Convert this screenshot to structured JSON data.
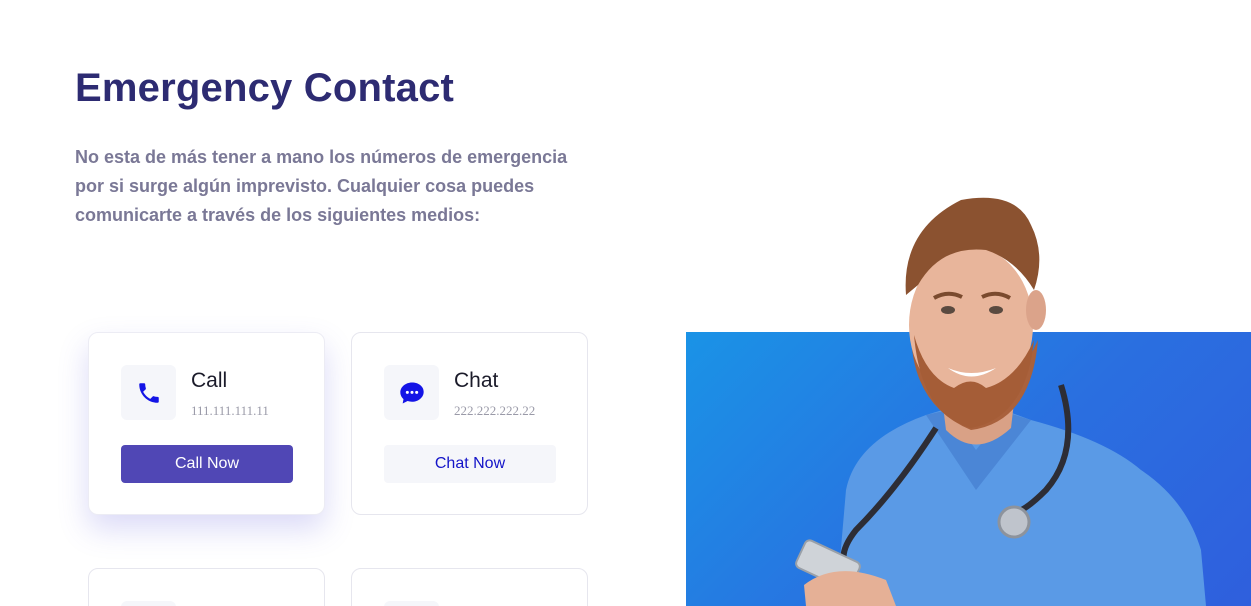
{
  "section": {
    "title": "Emergency Contact",
    "description": "No esta de más tener a mano los números de emergencia por si surge algún imprevisto. Cualquier cosa puedes comunicarte a través de los siguientes medios:"
  },
  "contacts": [
    {
      "label": "Call",
      "number": "111.111.111.11",
      "button": "Call Now",
      "icon": "phone-icon"
    },
    {
      "label": "Chat",
      "number": "222.222.222.22",
      "button": "Chat Now",
      "icon": "chat-icon"
    }
  ],
  "colors": {
    "title": "#2d2b72",
    "text": "#7a7896",
    "primary_button": "#5047b5",
    "icon_blue": "#1414e6",
    "hero_blue": "#1a93e6"
  },
  "image": {
    "subject": "doctor-with-stethoscope-and-phone"
  }
}
